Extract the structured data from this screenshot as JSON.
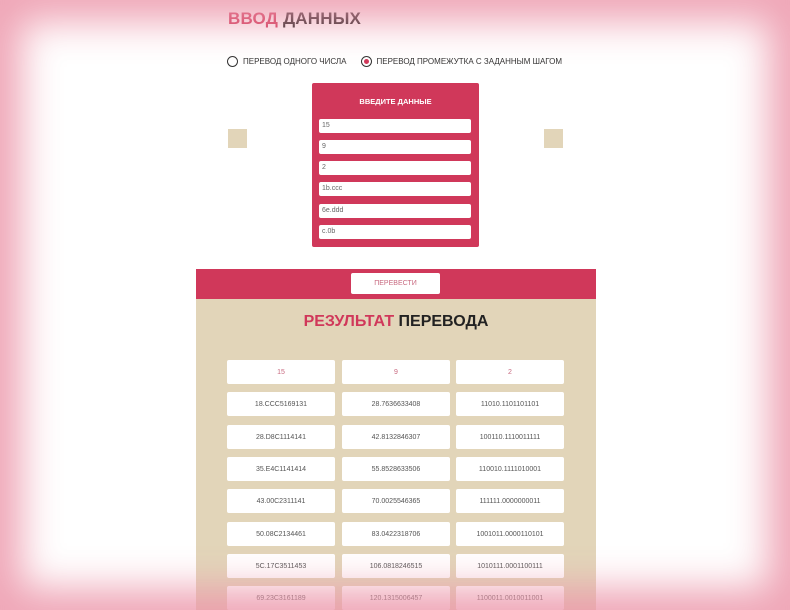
{
  "input_section": {
    "title_accent": "ВВОД",
    "title_rest": " ДАННЫХ",
    "radio_options": [
      {
        "label": "ПЕРЕВОД ОДНОГО ЧИСЛА",
        "selected": false
      },
      {
        "label": "ПЕРЕВОД ПРОМЕЖУТКА С ЗАДАННЫМ ШАГОМ",
        "selected": true
      }
    ],
    "panel_title": "ВВЕДИТЕ ДАННЫЕ",
    "fields": [
      "15",
      "9",
      "2",
      "1b.ccc",
      "6e.ddd",
      "c.0b"
    ]
  },
  "convert_button": "ПЕРЕВЕСТИ",
  "result_section": {
    "title_accent": "РЕЗУЛЬТАТ",
    "title_rest": " ПЕРЕВОДА",
    "headers": [
      "15",
      "9",
      "2"
    ],
    "rows": [
      [
        "18.CCC5169131",
        "28.7636633408",
        "11010.1101101101"
      ],
      [
        "28.D8C1114141",
        "42.8132846307",
        "100110.1110011111"
      ],
      [
        "35.E4C1141414",
        "55.8528633506",
        "110010.1111010001"
      ],
      [
        "43.00C2311141",
        "70.0025546365",
        "111111.0000000011"
      ],
      [
        "50.08C2134461",
        "83.0422318706",
        "1001011.0000110101"
      ],
      [
        "5C.17C3511453",
        "106.0818246515",
        "1010111.0001100111"
      ],
      [
        "69.23C3161189",
        "120.1315006457",
        "1100011.0010011001"
      ]
    ]
  },
  "colors": {
    "accent": "#d0385a",
    "beige": "#e2d5b9"
  }
}
